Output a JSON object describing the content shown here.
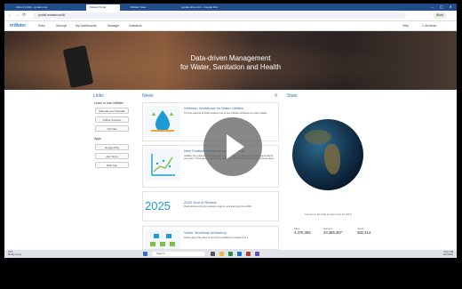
{
  "browser": {
    "tabs": [
      {
        "label": "Inbox (1,193) - [email protected]"
      },
      {
        "label": "mWater Portal"
      },
      {
        "label": "mWater Sites"
      },
      {
        "label": "google.drive.com - Google Driv"
      }
    ],
    "url": "portal.mwater.co/#/",
    "profile_label": "Work"
  },
  "site": {
    "logo": "mWater",
    "nav": [
      "Sites",
      "Surveys",
      "My Dashboards",
      "Manager",
      "Indicators"
    ],
    "help": "Help",
    "user": "1 Universe"
  },
  "hero": {
    "line1": "Data-driven Management",
    "line2": "for Water, Sanitation and Health"
  },
  "links": {
    "heading": "Links",
    "learn": "Learn to Use mWater",
    "buttons": [
      "Manuals and Tutorials",
      "Online Courses",
      "YouTube"
    ],
    "apps_heading": "Apps",
    "apps": [
      "Google Play",
      "App Store",
      "Web App"
    ]
  },
  "news": {
    "heading": "News",
    "items": [
      {
        "title": "Webinar: Workflows for Water Utilities",
        "text": "The first webinar of 2025 explains how to use mWater workflows for water utilities."
      },
      {
        "title": "New Feature: Workflow Improvements",
        "text": "mWater has enhanced workflow automation so you can set up and modify approvals for your team. This feature upgrade is available in all Performance Pro and Enterprise plans."
      },
      {
        "title": "2025 Year in Review",
        "text": "Read all about the key features, projects, and learnings from 2025.",
        "badge": "2025"
      },
      {
        "title": "Video: Workflow Workshop",
        "text": "Follow along this video to see how a workflow is created to fit a"
      }
    ]
  },
  "stats": {
    "heading": "Stats",
    "caption": "Surveys in the Past 24 Hours (14:07 GMT)",
    "labels": [
      "Sites",
      "Surveys",
      "Users"
    ],
    "values": [
      "4,470,363",
      "43,355,487",
      "382,214"
    ]
  },
  "taskbar": {
    "weather_temp": "79°F",
    "weather_desc": "Mostly sunny",
    "search_placeholder": "Search",
    "time": "11:07 AM",
    "date": "1/27/2026"
  },
  "colors": {
    "brand": "#2e6fb0",
    "tabbar": "#1f4e8a"
  },
  "video": {
    "icon": "play-icon"
  }
}
